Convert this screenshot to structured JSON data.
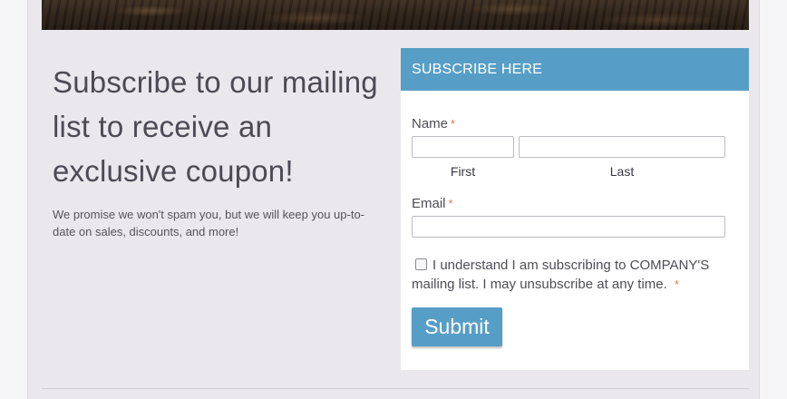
{
  "intro": {
    "headline": "Subscribe to our mailing list to receive an exclusive coupon!",
    "promise": "We promise we won't spam you, but we will keep you up-to-date on sales, discounts, and more!"
  },
  "form": {
    "header": "SUBSCRIBE HERE",
    "name_label": "Name",
    "first_label": "First",
    "last_label": "Last",
    "first_value": "",
    "last_value": "",
    "email_label": "Email",
    "email_value": "",
    "required_mark": "*",
    "consent_text": "I understand I am subscribing to COMPANY'S mailing list. I may unsubscribe at any time.",
    "consent_checked": false,
    "submit_label": "Submit"
  },
  "colors": {
    "accent": "#579ec6",
    "required": "#e07a4a"
  }
}
